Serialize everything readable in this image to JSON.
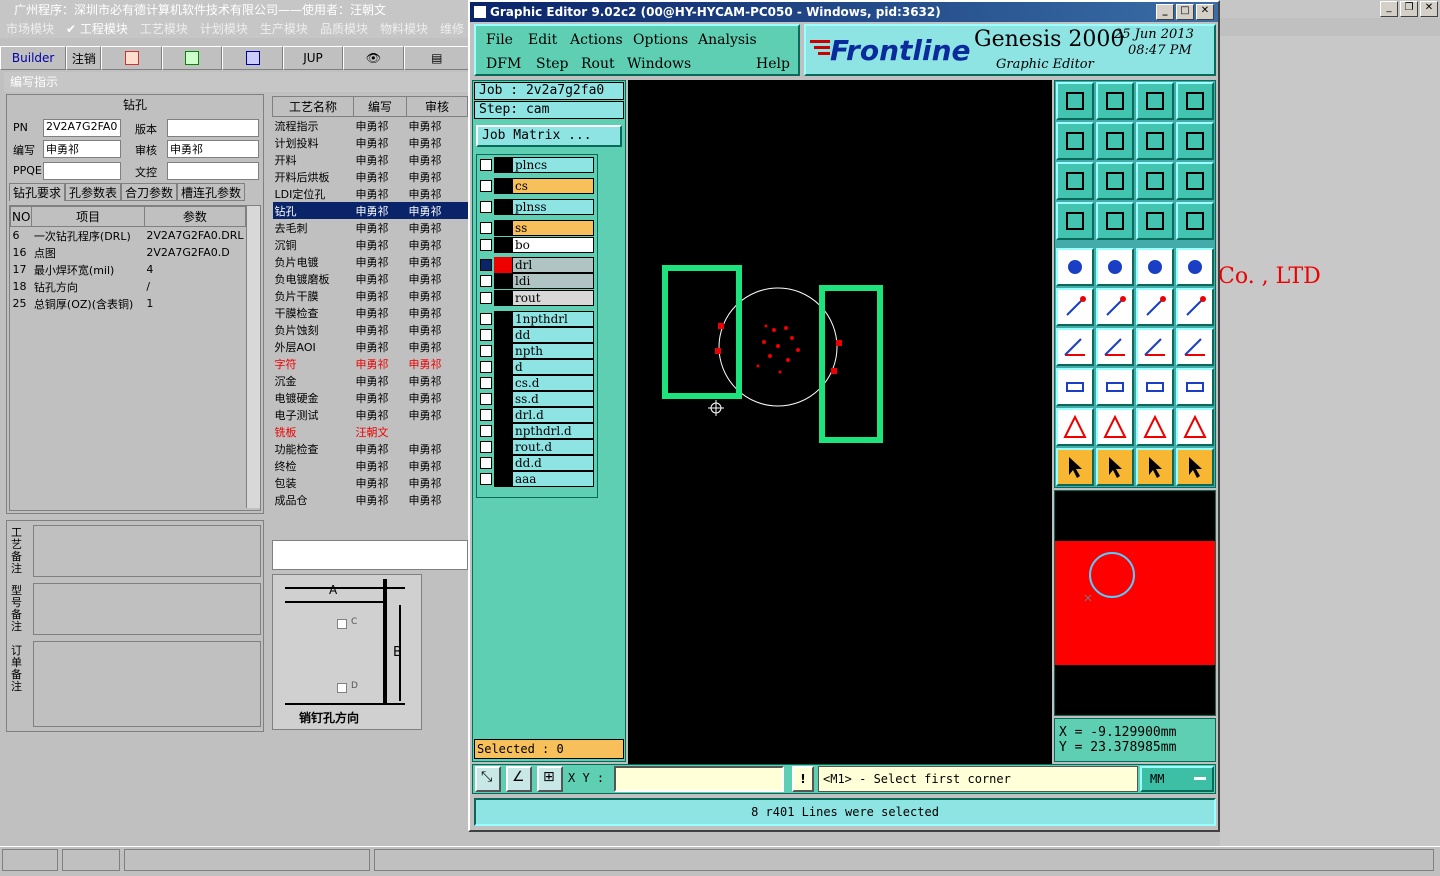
{
  "bg_app": {
    "title": "广州程序：深圳市必有德计算机软件技术有限公司——使用者：汪朝文",
    "menu": [
      "市场模块",
      "✔ 工程模块",
      "工艺模块",
      "计划模块",
      "生产模块",
      "品质模块",
      "物料模块",
      "维修"
    ],
    "toolbar": {
      "builder": "Builder",
      "logout": "注销",
      "jup": "JUP"
    },
    "panel_title": "编写指示",
    "section_title": "钻孔",
    "fields": {
      "pn_label": "PN",
      "pn_value": "2V2A7G2FA0",
      "version_label": "版本",
      "version_value": "",
      "author_label": "编写",
      "author_value": "申勇祁",
      "reviewer_label": "审核",
      "reviewer_value": "申勇祁",
      "ppqe_label": "PPQE",
      "ppqe_value": "",
      "doc_label": "文控",
      "doc_value": ""
    },
    "tabs": [
      "钻孔要求",
      "孔参数表",
      "合刀参数",
      "槽连孔参数"
    ],
    "req_table": {
      "headers": [
        "NO",
        "项目",
        "参数"
      ],
      "rows": [
        [
          "6",
          "一次钻孔程序(DRL)",
          "2V2A7G2FA0.DRL"
        ],
        [
          "16",
          "点图",
          "2V2A7G2FA0.D"
        ],
        [
          "17",
          "最小焊环宽(mil)",
          "4"
        ],
        [
          "18",
          "钻孔方向",
          "/"
        ],
        [
          "25",
          "总铜厚(OZ)(含表铜)",
          "1"
        ]
      ]
    },
    "remarks": [
      "工艺备注",
      "型号备注",
      "订单备注"
    ],
    "process_table": {
      "headers": [
        "工艺名称",
        "编写",
        "审核"
      ],
      "rows": [
        [
          "流程指示",
          "申勇祁",
          "申勇祁"
        ],
        [
          "计划投料",
          "申勇祁",
          "申勇祁"
        ],
        [
          "开料",
          "申勇祁",
          "申勇祁"
        ],
        [
          "开料后烘板",
          "申勇祁",
          "申勇祁"
        ],
        [
          "LDI定位孔",
          "申勇祁",
          "申勇祁"
        ],
        [
          "钻孔",
          "申勇祁",
          "申勇祁"
        ],
        [
          "去毛刺",
          "申勇祁",
          "申勇祁"
        ],
        [
          "沉铜",
          "申勇祁",
          "申勇祁"
        ],
        [
          "负片电镀",
          "申勇祁",
          "申勇祁"
        ],
        [
          "负电镀磨板",
          "申勇祁",
          "申勇祁"
        ],
        [
          "负片干膜",
          "申勇祁",
          "申勇祁"
        ],
        [
          "干膜检查",
          "申勇祁",
          "申勇祁"
        ],
        [
          "负片蚀刻",
          "申勇祁",
          "申勇祁"
        ],
        [
          "外层AOI",
          "申勇祁",
          "申勇祁"
        ],
        [
          "字符",
          "申勇祁",
          "申勇祁"
        ],
        [
          "沉金",
          "申勇祁",
          "申勇祁"
        ],
        [
          "电镀硬金",
          "申勇祁",
          "申勇祁"
        ],
        [
          "电子测试",
          "申勇祁",
          "申勇祁"
        ],
        [
          "铣板",
          "汪朝文",
          ""
        ],
        [
          "功能检查",
          "申勇祁",
          "申勇祁"
        ],
        [
          "终检",
          "申勇祁",
          "申勇祁"
        ],
        [
          "包装",
          "申勇祁",
          "申勇祁"
        ],
        [
          "成品仓",
          "申勇祁",
          "申勇祁"
        ]
      ]
    },
    "diagram": {
      "label_a": "A",
      "label_b": "B",
      "label_c": "C",
      "label_d": "D",
      "caption": "销钉孔方向"
    },
    "co_text": "Co. , LTD"
  },
  "genesis": {
    "title": "Graphic Editor 9.02c2 (00@HY-HYCAM-PC050 - Windows, pid:3632)",
    "menu_row1": [
      "File",
      "Edit",
      "Actions",
      "Options",
      "Analysis"
    ],
    "menu_row2": [
      "DFM",
      "Step",
      "Rout",
      "Windows",
      "Help"
    ],
    "brand": "Frontline",
    "product": "Genesis 2000",
    "subtitle": "Graphic Editor",
    "date": "25 Jun 2013",
    "time": "08:47 PM",
    "job": "Job : 2v2a7g2fa0",
    "step": "Step: cam",
    "job_matrix": "Job Matrix ...",
    "layers": [
      {
        "name": "plncs",
        "color": "#8ee3e3"
      },
      {
        "name": "cs",
        "color": "#f7c05a"
      },
      {
        "name": "plnss",
        "color": "#8ee3e3"
      },
      {
        "name": "ss",
        "color": "#f7c05a"
      },
      {
        "name": "bo",
        "color": "#ffffff"
      },
      {
        "name": "drl",
        "color": "#b0c4c4"
      },
      {
        "name": "ldi",
        "color": "#b0c4c4"
      },
      {
        "name": "rout",
        "color": "#d8d8d8"
      },
      {
        "name": "1npthdrl",
        "color": "#8ee3e3"
      },
      {
        "name": "dd",
        "color": "#8ee3e3"
      },
      {
        "name": "npth",
        "color": "#8ee3e3"
      },
      {
        "name": "d",
        "color": "#8ee3e3"
      },
      {
        "name": "cs.d",
        "color": "#8ee3e3"
      },
      {
        "name": "ss.d",
        "color": "#8ee3e3"
      },
      {
        "name": "drl.d",
        "color": "#8ee3e3"
      },
      {
        "name": "npthdrl.d",
        "color": "#8ee3e3"
      },
      {
        "name": "rout.d",
        "color": "#8ee3e3"
      },
      {
        "name": "dd.d",
        "color": "#8ee3e3"
      },
      {
        "name": "aaa",
        "color": "#8ee3e3"
      }
    ],
    "selected": "Selected : 0",
    "coord_x": "X  =  -9.129900mm",
    "coord_y": "Y  =  23.378985mm",
    "xy_label": "X Y :",
    "xy_value": "",
    "prompt": "<M1> - Select first corner",
    "units": "MM",
    "message": "8 r401 Lines were selected"
  }
}
